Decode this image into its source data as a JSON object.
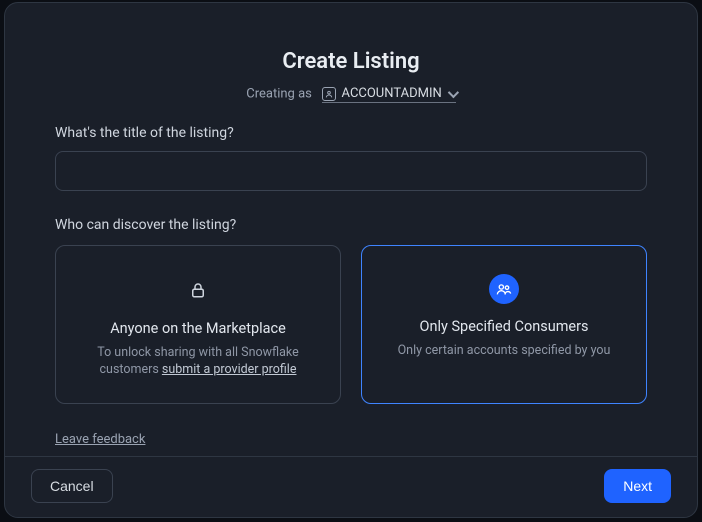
{
  "dialog": {
    "title": "Create Listing",
    "creating_as_prefix": "Creating as",
    "role": "ACCOUNTADMIN"
  },
  "fields": {
    "title_label": "What's the title of the listing?",
    "title_value": ""
  },
  "discover": {
    "label": "Who can discover the listing?",
    "options": [
      {
        "title": "Anyone on the Marketplace",
        "desc_prefix": "To unlock sharing with all Snowflake customers ",
        "link_text": "submit a provider profile"
      },
      {
        "title": "Only Specified Consumers",
        "desc": "Only certain accounts specified by you"
      }
    ],
    "selected_index": 1
  },
  "feedback_label": "Leave feedback",
  "footer": {
    "cancel": "Cancel",
    "next": "Next"
  },
  "colors": {
    "accent": "#1f63ff",
    "surface": "#1a1f29",
    "border": "#3a4250"
  }
}
